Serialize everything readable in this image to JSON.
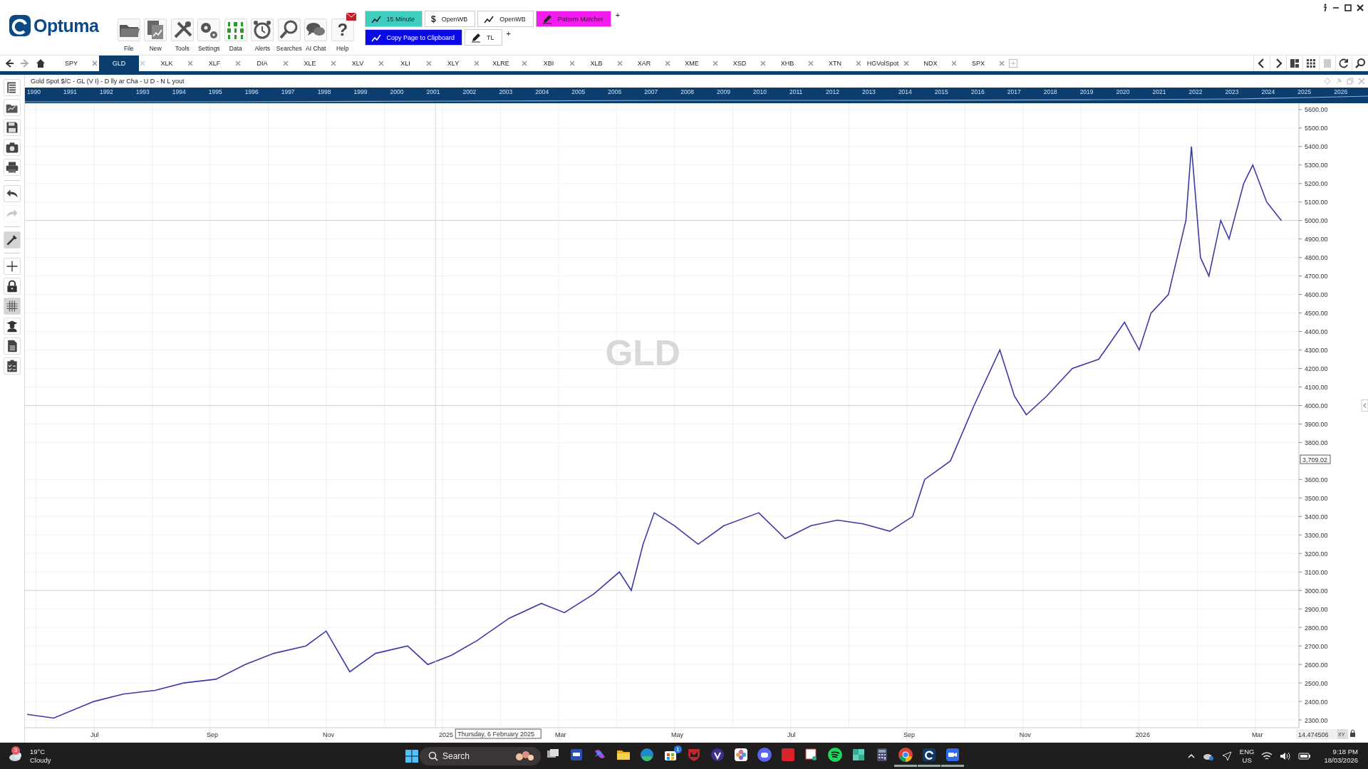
{
  "logo": {
    "text": "Optuma"
  },
  "main_toolbar": [
    {
      "label": "File",
      "kind": "folder"
    },
    {
      "label": "New",
      "kind": "new"
    },
    {
      "label": "Tools",
      "kind": "tools"
    },
    {
      "label": "Settings",
      "kind": "settings"
    },
    {
      "label": "Data",
      "kind": "data"
    },
    {
      "label": "Alerts",
      "kind": "alerts"
    },
    {
      "label": "Searches",
      "kind": "search"
    },
    {
      "label": "AI Chat",
      "kind": "chat"
    },
    {
      "label": "Help",
      "kind": "help",
      "glyph": "?"
    }
  ],
  "workspace_rows": [
    [
      {
        "label": "15 Minute",
        "kind": "chart",
        "color": "#3ecdbf"
      },
      {
        "label": "OpenWB",
        "kind": "dollar",
        "color": "#ffffff",
        "glyph": "$"
      },
      {
        "label": "OpenWB",
        "kind": "chart",
        "color": "#ffffff"
      },
      {
        "label": "Pattern Matcher",
        "kind": "pen",
        "color": "#f21cef"
      }
    ],
    [
      {
        "label": "Copy Page to Clipboard",
        "kind": "chart",
        "color": "#0a0ae6"
      },
      {
        "label": "TL",
        "kind": "pen",
        "color": "#ffffff"
      }
    ]
  ],
  "add_glyph": "+",
  "tabs": [
    {
      "label": "SPY",
      "selected": false
    },
    {
      "label": "GLD",
      "selected": true
    },
    {
      "label": "XLK",
      "selected": false
    },
    {
      "label": "XLF",
      "selected": false
    },
    {
      "label": "DIA",
      "selected": false
    },
    {
      "label": "XLE",
      "selected": false
    },
    {
      "label": "XLV",
      "selected": false
    },
    {
      "label": "XLI",
      "selected": false
    },
    {
      "label": "XLY",
      "selected": false
    },
    {
      "label": "XLRE",
      "selected": false
    },
    {
      "label": "XBI",
      "selected": false
    },
    {
      "label": "XLB",
      "selected": false
    },
    {
      "label": "XAR",
      "selected": false
    },
    {
      "label": "XME",
      "selected": false
    },
    {
      "label": "XSD",
      "selected": false
    },
    {
      "label": "XHB",
      "selected": false
    },
    {
      "label": "XTN",
      "selected": false
    },
    {
      "label": "HGVolSpot",
      "selected": false
    },
    {
      "label": "NDX",
      "selected": false
    },
    {
      "label": "SPX",
      "selected": false
    }
  ],
  "sidebar": [
    {
      "kind": "tree",
      "on": false,
      "disabled": false
    },
    {
      "kind": "folder",
      "on": false,
      "disabled": false
    },
    {
      "kind": "save",
      "on": false,
      "disabled": false
    },
    {
      "kind": "camera",
      "on": false,
      "disabled": false
    },
    {
      "kind": "print",
      "on": false,
      "disabled": false
    },
    {
      "kind": "undo",
      "on": false,
      "disabled": false
    },
    {
      "kind": "redo",
      "on": false,
      "disabled": true
    },
    {
      "kind": "wrench",
      "on": true,
      "disabled": false
    },
    {
      "kind": "plus",
      "on": false,
      "disabled": false
    },
    {
      "kind": "lock",
      "on": false,
      "disabled": false
    },
    {
      "kind": "grid",
      "on": true,
      "disabled": false
    },
    {
      "kind": "student",
      "on": false,
      "disabled": false
    },
    {
      "kind": "document",
      "on": false,
      "disabled": false
    },
    {
      "kind": "checklist",
      "on": false,
      "disabled": false
    }
  ],
  "chart": {
    "title": "Gold Spot $/C - GL (V I) - D lly ar Cha - U D - N L yout",
    "timeline_years": [
      "1990",
      "1991",
      "1992",
      "1993",
      "1994",
      "1995",
      "1996",
      "1997",
      "1998",
      "1999",
      "2000",
      "2001",
      "2002",
      "2003",
      "2004",
      "2005",
      "2006",
      "2007",
      "2008",
      "2009",
      "2010",
      "2011",
      "2012",
      "2013",
      "2014",
      "2015",
      "2016",
      "2017",
      "2018",
      "2019",
      "2020",
      "2021",
      "2022",
      "2023",
      "2024",
      "2025",
      "2026"
    ],
    "crosshair": {
      "price": "3,709.02",
      "date": "Thursday, 6 February 2025"
    },
    "scale_reading": "14.474506",
    "scale_mode": "XY",
    "chart_data": {
      "type": "line",
      "grid": true,
      "ref_lines": [
        {
          "axis": "x",
          "value": 2024.99
        }
      ],
      "xlim": [
        2024.4008,
        2026.2292
      ],
      "ylim": [
        2258,
        5634
      ],
      "xticks": [
        {
          "value": 2024.5,
          "label": "Jul"
        },
        {
          "value": 2024.6667,
          "label": "Sep"
        },
        {
          "value": 2024.8333,
          "label": "Nov"
        },
        2025,
        {
          "value": 2025.1667,
          "label": "Mar"
        },
        {
          "value": 2025.3333,
          "label": "May"
        },
        {
          "value": 2025.5,
          "label": "Jul"
        },
        {
          "value": 2025.6667,
          "label": "Sep"
        },
        {
          "value": 2025.8333,
          "label": "Nov"
        },
        2026,
        {
          "value": 2026.1667,
          "label": "Mar"
        }
      ],
      "yticks": [
        {
          "value": 2300,
          "label": "2300.00"
        },
        {
          "value": 2400,
          "label": "2400.00"
        },
        {
          "value": 2500,
          "label": "2500.00"
        },
        {
          "value": 2600,
          "label": "2600.00"
        },
        {
          "value": 2700,
          "label": "2700.00"
        },
        {
          "value": 2800,
          "label": "2800.00"
        },
        {
          "value": 2900,
          "label": "2900.00"
        },
        {
          "value": 3000,
          "label": "3000.00"
        },
        {
          "value": 3100,
          "label": "3100.00"
        },
        {
          "value": 3200,
          "label": "3200.00"
        },
        {
          "value": 3300,
          "label": "3300.00"
        },
        {
          "value": 3400,
          "label": "3400.00"
        },
        {
          "value": 3500,
          "label": "3500.00"
        },
        {
          "value": 3600,
          "label": "3600.00"
        },
        {
          "value": 3800,
          "label": "3800.00"
        },
        {
          "value": 3900,
          "label": "3900.00"
        },
        {
          "value": 4000,
          "label": "4000.00"
        },
        {
          "value": 4100,
          "label": "4100.00"
        },
        {
          "value": 4200,
          "label": "4200.00"
        },
        {
          "value": 4300,
          "label": "4300.00"
        },
        {
          "value": 4400,
          "label": "4400.00"
        },
        {
          "value": 4500,
          "label": "4500.00"
        },
        {
          "value": 4600,
          "label": "4600.00"
        },
        {
          "value": 4700,
          "label": "4700.00"
        },
        {
          "value": 4800,
          "label": "4800.00"
        },
        {
          "value": 4900,
          "label": "4900.00"
        },
        {
          "value": 5000,
          "label": "5000.00"
        },
        {
          "value": 5100,
          "label": "5100.00"
        },
        {
          "value": 5200,
          "label": "5200.00"
        },
        {
          "value": 5300,
          "label": "5300.00"
        },
        {
          "value": 5400,
          "label": "5400.00"
        },
        {
          "value": 5500,
          "label": "5500.00"
        },
        {
          "value": 5600,
          "label": "5600.00"
        }
      ],
      "x": [
        2024.404,
        2024.442,
        2024.5,
        2024.542,
        2024.588,
        2024.629,
        2024.675,
        2024.717,
        2024.758,
        2024.804,
        2024.833,
        2024.867,
        2024.904,
        2024.95,
        2024.979,
        2025.013,
        2025.05,
        2025.096,
        2025.142,
        2025.175,
        2025.217,
        2025.254,
        2025.271,
        2025.288,
        2025.304,
        2025.333,
        2025.367,
        2025.404,
        2025.454,
        2025.492,
        2025.529,
        2025.567,
        2025.604,
        2025.642,
        2025.675,
        2025.692,
        2025.729,
        2025.763,
        2025.8,
        2025.821,
        2025.838,
        2025.867,
        2025.904,
        2025.942,
        2025.979,
        2026.0,
        2026.017,
        2026.042,
        2026.067,
        2026.075,
        2026.088,
        2026.1,
        2026.117,
        2026.129,
        2026.15,
        2026.163,
        2026.183,
        2026.204
      ],
      "series": [
        {
          "name": "GLD",
          "color": "#3a3aa8",
          "values": [
            2330,
            2310,
            2400,
            2440,
            2460,
            2500,
            2520,
            2600,
            2660,
            2700,
            2780,
            2560,
            2660,
            2700,
            2600,
            2650,
            2730,
            2850,
            2930,
            2880,
            2980,
            3100,
            3000,
            3250,
            3420,
            3350,
            3250,
            3350,
            3420,
            3280,
            3350,
            3380,
            3360,
            3320,
            3400,
            3600,
            3700,
            4000,
            4300,
            4050,
            3950,
            4050,
            4200,
            4250,
            4450,
            4300,
            4500,
            4600,
            5000,
            5400,
            4800,
            4700,
            5000,
            4900,
            5200,
            5300,
            5100,
            5000
          ]
        }
      ]
    }
  },
  "taskbar": {
    "weather": {
      "badge": "3",
      "temperature": "19°C",
      "condition": "Cloudy"
    },
    "search_placeholder": "Search",
    "apps": [
      {
        "kind": "taskview",
        "running": false
      },
      {
        "kind": "printer",
        "running": false
      },
      {
        "kind": "copilot",
        "running": false
      },
      {
        "kind": "folder",
        "running": false
      },
      {
        "kind": "edge",
        "running": false
      },
      {
        "kind": "store",
        "running": false,
        "badge": "1"
      },
      {
        "kind": "shield",
        "running": false
      },
      {
        "kind": "vpn",
        "running": false
      },
      {
        "kind": "flower",
        "running": false
      },
      {
        "kind": "discord",
        "running": false
      },
      {
        "kind": "redapp",
        "running": false
      },
      {
        "kind": "snip",
        "running": false
      },
      {
        "kind": "spotify",
        "running": false
      },
      {
        "kind": "leaf",
        "running": false
      },
      {
        "kind": "calculator",
        "running": false
      },
      {
        "kind": "chrome",
        "running": true
      },
      {
        "kind": "optuma",
        "running": true
      },
      {
        "kind": "zoom",
        "running": true
      }
    ],
    "language": "ENG",
    "region": "US",
    "time": "9:18 PM",
    "date": "18/03/2026"
  }
}
